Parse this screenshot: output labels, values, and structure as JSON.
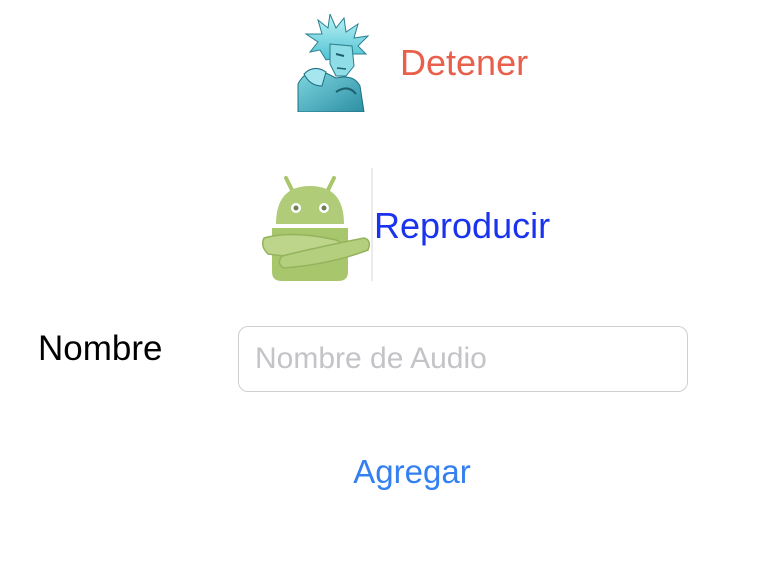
{
  "stop_button": {
    "label": "Detener",
    "color": "#e8604c",
    "image_icon": "blue-spiky-hair-character-icon"
  },
  "play_button": {
    "label": "Reproducir",
    "color": "#1a33ee",
    "image_icon": "android-robot-arms-crossed-icon"
  },
  "form": {
    "name_label": "Nombre",
    "name_value": "",
    "name_placeholder": "Nombre de Audio"
  },
  "add_button": {
    "label": "Agregar",
    "color": "#3480f0"
  }
}
